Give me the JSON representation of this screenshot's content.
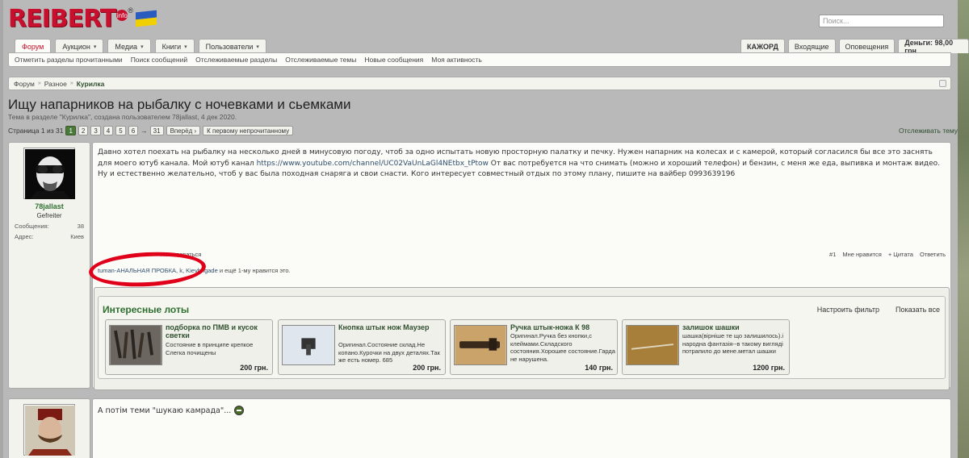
{
  "header": {
    "logo_text": "REIBERT",
    "logo_reg": "®",
    "logo_info": "info",
    "search_placeholder": "Поиск...",
    "flag_colors": [
      "#2a5bbf",
      "#f0d000"
    ]
  },
  "nav": {
    "tabs": [
      {
        "label": "Форум",
        "caret": ""
      },
      {
        "label": "Аукцион",
        "caret": "▾"
      },
      {
        "label": "Медиа",
        "caret": "▾"
      },
      {
        "label": "Книги",
        "caret": "▾"
      },
      {
        "label": "Пользователи",
        "caret": "▾"
      }
    ],
    "right_tabs": [
      "КАЖОРД",
      "Входящие",
      "Оповещения",
      "Деньги: 98,00 грн"
    ],
    "subnav": [
      "Отметить разделы прочитанными",
      "Поиск сообщений",
      "Отслеживаемые разделы",
      "Отслеживаемые темы",
      "Новые сообщения",
      "Моя активность"
    ]
  },
  "breadcrumb": {
    "items": [
      "Форум",
      "Разное",
      "Курилка"
    ],
    "sep": "»"
  },
  "thread": {
    "title": "Ищу напарников на рыбалку с ночевками и сьемками",
    "subtitle": "Тема в разделе \"Курилка\", создана пользователем 78jallast, 4 дек 2020.",
    "watch": "Отслеживать тему"
  },
  "pager": {
    "label": "Страница 1 из 31",
    "pages": [
      "1",
      "2",
      "3",
      "4",
      "5",
      "6"
    ],
    "arrow": "→",
    "last": "31",
    "next": "Вперёд ›",
    "first_unread": "К первому непрочитанному"
  },
  "post1": {
    "username": "78jallast",
    "usertitle": "Gefreiter",
    "info": [
      {
        "k": "Сообщения:",
        "v": "38"
      },
      {
        "k": "Адрес:",
        "v": "Киев"
      }
    ],
    "text_before": "Давно хотел поехать на рыбалку на несколько дней в минусовую погоду, чтоб за одно испытать новую просторную палатку и печку. Нужен напарник на колесах и с камерой, который согласился бы все это заснять для моего ютуб канала. Мой ютуб канал ",
    "text_link": "https://www.youtube.com/channel/UC02VaUnLaGl4NEtbx_tPtow",
    "text_after": " От вас потребуется на что снимать (можно и хороший телефон) и бензин, с меня же еда, выпивка и монтаж видео. Ну и естественно желательно, чтоб у вас была походная снаряга и свои снасти. Кого интересует совместный отдых по этому плану, пишите на вайбер 0993639196",
    "report": "Пожаловаться",
    "actions": [
      "#1",
      "Мне нравится",
      "+ Цитата",
      "Ответить"
    ],
    "likes_1": "tuman-АНАЛЬНАЯ ПРОБКА",
    "likes_2": "k",
    "likes_3": "Kievbrigade",
    "likes_tail": "и ещё 1-му нравится это."
  },
  "lots": {
    "title": "Интересные лоты",
    "links": [
      "Настроить фильтр",
      "Показать все"
    ],
    "items": [
      {
        "title": "подборка по ПМВ и кусок светки",
        "desc": "Состояние в принципе крепкое Слегка почищены",
        "price": "200 грн."
      },
      {
        "title": "Кнопка штык нож Маузер",
        "desc": "Оригинал.Состояние склад.Не копано.Курочки на двух деталях.Так же есть номер. 685",
        "price": "200 грн."
      },
      {
        "title": "Ручка штык-ножа К 98",
        "desc": "Оригинал.Ручка без кнопки,с клеймами.Складского состояния.Хорошее состояние.Гарда не нарушена.",
        "price": "140 грн."
      },
      {
        "title": "залишок шашки",
        "desc": "шашка(вірніше те що залишилось).і народна фантазія--в такому вигляді потрапило до мене.метал шашки",
        "price": "1200 грн."
      }
    ]
  },
  "post2": {
    "text": "А потім теми \"шукаю камрада\"..."
  }
}
